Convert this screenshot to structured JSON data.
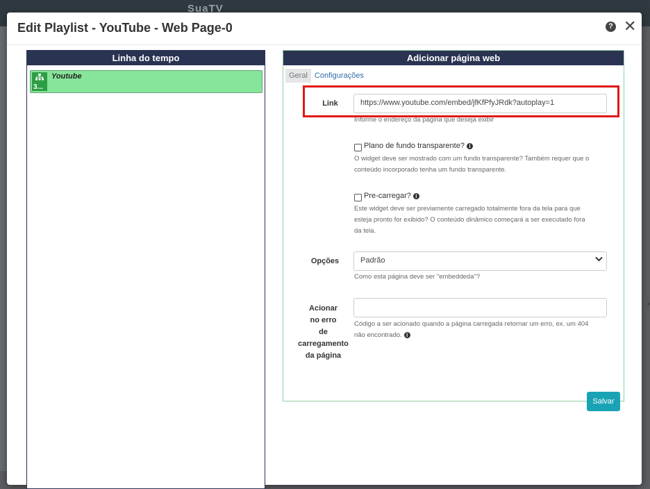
{
  "app": {
    "brand": "SuaTV"
  },
  "modal": {
    "title": "Edit Playlist - YouTube - Web Page-0",
    "help_glyph": "?",
    "close_glyph": "✕"
  },
  "timeline": {
    "title": "Linha do tempo",
    "items": [
      {
        "name": "Youtube",
        "duration": "3...",
        "icon": "sitemap-icon",
        "color": "#86e59a"
      }
    ]
  },
  "form": {
    "title": "Adicionar página web",
    "tabs": [
      {
        "label": "Geral",
        "active": true
      },
      {
        "label": "Configurações",
        "active": false
      }
    ],
    "link": {
      "label": "Link",
      "value": "https://www.youtube.com/embed/jfKfPfyJRdk?autoplay=1",
      "hint": "Informe o endereço da página que deseja exibir"
    },
    "transparent": {
      "label": "Plano de fundo transparente?",
      "checked": false,
      "hint_lines": [
        "O widget deve ser mostrado com um fundo transparente? Também requer que o",
        "conteúdo incorporado tenha um fundo transparente."
      ]
    },
    "preload": {
      "label": "Pre-carregar?",
      "checked": false,
      "hint_lines": [
        "Este widget deve ser previamente carregado totalmente fora da tela para que",
        "esteja pronto for exibido? O conteúdo dinâmico começará a ser executado fora",
        "da tela."
      ]
    },
    "options": {
      "label": "Opções",
      "selected": "Padrão",
      "hint": "Como esta página deve ser \"embeddeda\"?"
    },
    "on_error": {
      "label_lines": [
        "Acionar",
        "no erro",
        "de",
        "carregamento",
        "da página"
      ],
      "value": "",
      "hint_lines": [
        "Código a ser acionado quando a página carregada retornar um erro, ex. um 404",
        "não encontrado."
      ]
    },
    "save_label": "Salvar"
  },
  "colors": {
    "panel_header": "#2a3352",
    "accent": "#1aa3b5",
    "highlight": "#e01818"
  }
}
